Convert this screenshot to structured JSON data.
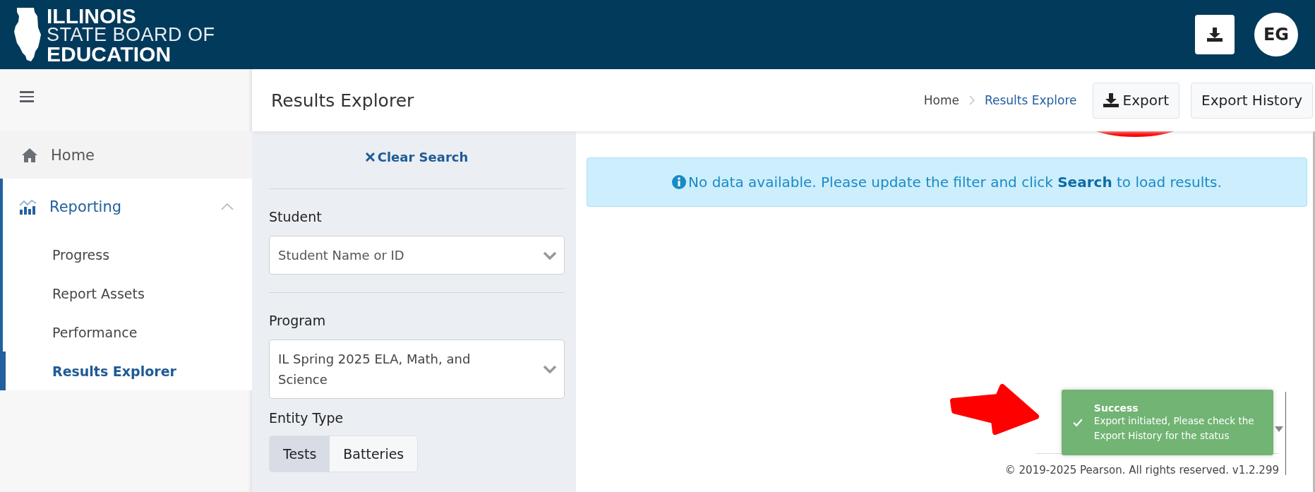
{
  "header": {
    "logo_lines": [
      "ILLINOIS",
      "STATE BOARD OF",
      "EDUCATION"
    ],
    "avatar": "EG"
  },
  "sidebar": {
    "items": [
      {
        "label": "Home",
        "selected": false
      },
      {
        "label": "Reporting",
        "selected": true,
        "expanded": true,
        "children": [
          {
            "label": "Progress",
            "selected": false
          },
          {
            "label": "Report Assets",
            "selected": false
          },
          {
            "label": "Performance",
            "selected": false
          },
          {
            "label": "Results Explorer",
            "selected": true
          }
        ]
      }
    ]
  },
  "top_bar": {
    "title": "Results Explorer",
    "breadcrumb": [
      {
        "label": "Home",
        "current": false
      },
      {
        "label": "Results Explore",
        "current": true
      }
    ],
    "buttons": [
      {
        "label": "Export"
      },
      {
        "label": "Export History"
      }
    ]
  },
  "filters": {
    "clear_search": "Clear Search",
    "student": {
      "label": "Student",
      "placeholder": "Student Name or ID"
    },
    "program": {
      "label": "Program",
      "value": "IL Spring 2025 ELA, Math, and Science"
    },
    "entity_type": {
      "label": "Entity Type",
      "options": [
        {
          "label": "Tests",
          "selected": true
        },
        {
          "label": "Batteries",
          "selected": false
        }
      ]
    }
  },
  "results": {
    "alert": "No data available. Please update the filter and click **Search** to load results.",
    "footer": "© 2019-2025 Pearson. All rights reserved. v1.2.299"
  },
  "toast": {
    "title": "Success",
    "message": "Export initiated, Please check the Export History for the status"
  }
}
